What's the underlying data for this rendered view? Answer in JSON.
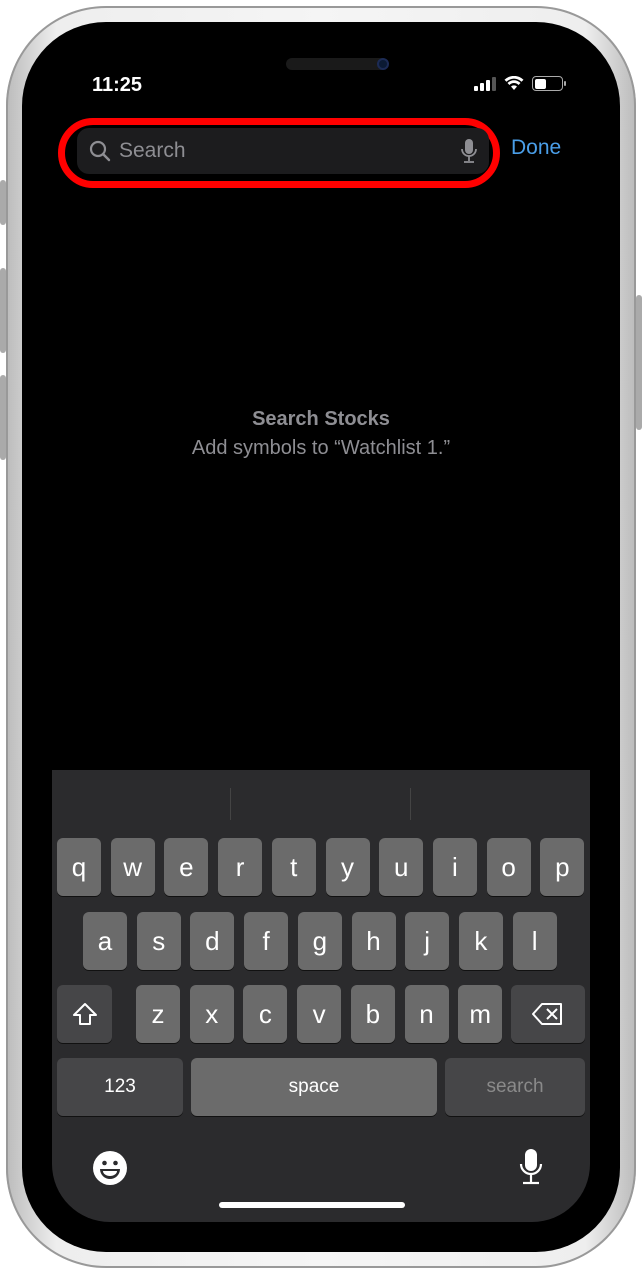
{
  "status_bar": {
    "time": "11:25",
    "battery_level": 0.45,
    "signal_bars": 3
  },
  "search": {
    "placeholder": "Search",
    "value": "",
    "done_label": "Done",
    "highlight_color": "#ff0000"
  },
  "empty_state": {
    "title": "Search Stocks",
    "subtitle": "Add symbols to “Watchlist 1.”"
  },
  "keyboard": {
    "row1": [
      "q",
      "w",
      "e",
      "r",
      "t",
      "y",
      "u",
      "i",
      "o",
      "p"
    ],
    "row2": [
      "a",
      "s",
      "d",
      "f",
      "g",
      "h",
      "j",
      "k",
      "l"
    ],
    "row3": [
      "z",
      "x",
      "c",
      "v",
      "b",
      "n",
      "m"
    ],
    "numbers_label": "123",
    "space_label": "space",
    "search_label": "search",
    "shift_icon": "shift-icon",
    "delete_icon": "delete-icon",
    "emoji_icon": "emoji-icon",
    "dictation_icon": "microphone-icon"
  },
  "colors": {
    "accent": "#4a9ee8",
    "key": "#6b6b6b",
    "key_dark": "#464648",
    "keyboard_bg": "#2b2b2d"
  }
}
